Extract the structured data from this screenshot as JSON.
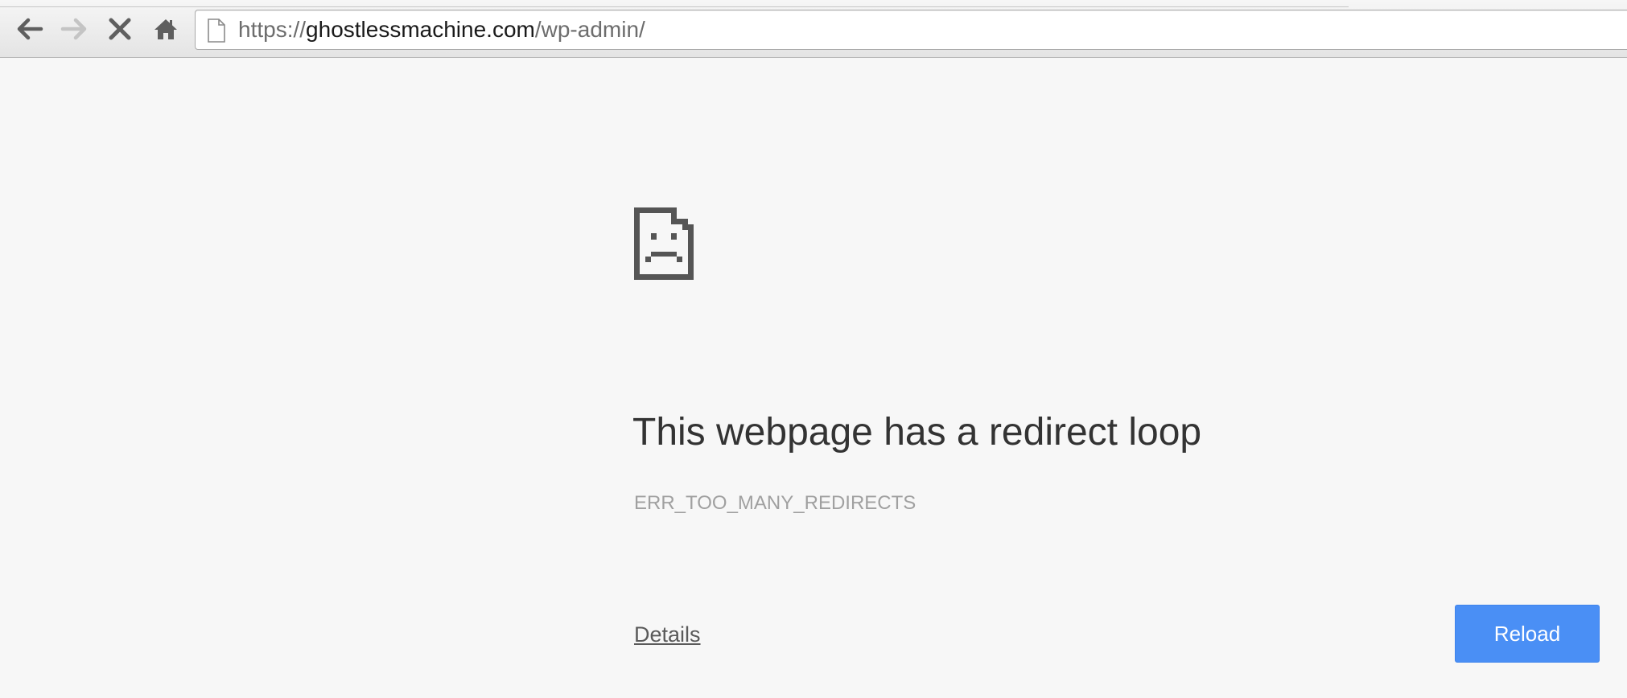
{
  "toolbar": {
    "back_icon": "back-arrow-icon",
    "forward_icon": "forward-arrow-icon",
    "stop_icon": "stop-x-icon",
    "home_icon": "home-icon",
    "page_icon": "blank-page-icon"
  },
  "omnibox": {
    "url_scheme": "https://",
    "url_host": "ghostlessmachine.com",
    "url_path": "/wp-admin/"
  },
  "error_page": {
    "icon": "sad-document-icon",
    "title": "This webpage has a redirect loop",
    "error_code": "ERR_TOO_MANY_REDIRECTS",
    "details_label": "Details",
    "reload_label": "Reload"
  },
  "colors": {
    "reload_button": "#4a8ff5",
    "title_text": "#333333",
    "error_code_text": "#a0a0a0",
    "background": "#f7f7f7"
  }
}
